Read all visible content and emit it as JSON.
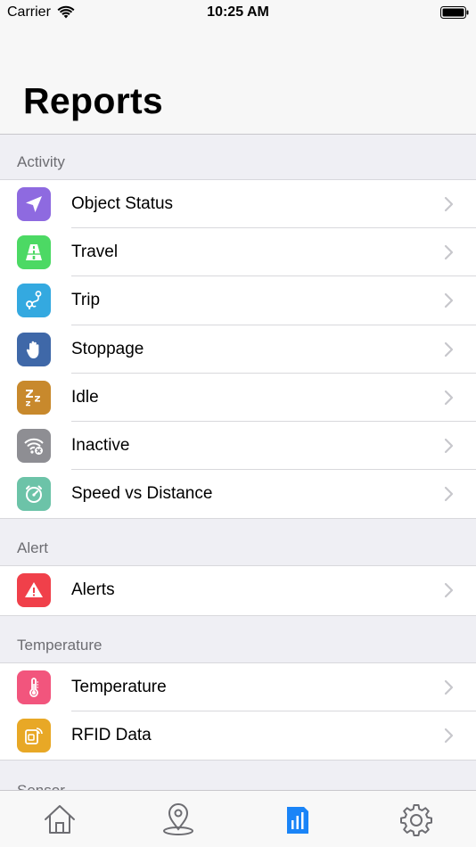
{
  "status_bar": {
    "carrier": "Carrier",
    "time": "10:25 AM"
  },
  "header": {
    "title": "Reports"
  },
  "sections": [
    {
      "title": "Activity",
      "items": [
        {
          "label": "Object Status",
          "icon": "navigation-arrow-icon",
          "color": "#8e6ae0"
        },
        {
          "label": "Travel",
          "icon": "road-icon",
          "color": "#4cd964"
        },
        {
          "label": "Trip",
          "icon": "route-pin-icon",
          "color": "#34a9e0"
        },
        {
          "label": "Stoppage",
          "icon": "hand-icon",
          "color": "#3f68a8"
        },
        {
          "label": "Idle",
          "icon": "sleep-zzz-icon",
          "color": "#c8892c"
        },
        {
          "label": "Inactive",
          "icon": "wifi-off-icon",
          "color": "#8e8e93"
        },
        {
          "label": "Speed vs Distance",
          "icon": "speedometer-icon",
          "color": "#6cc3a8"
        }
      ]
    },
    {
      "title": "Alert",
      "items": [
        {
          "label": "Alerts",
          "icon": "warning-icon",
          "color": "#f0404a"
        }
      ]
    },
    {
      "title": "Temperature",
      "items": [
        {
          "label": "Temperature",
          "icon": "thermometer-icon",
          "color": "#f2557d"
        },
        {
          "label": "RFID Data",
          "icon": "rfid-card-icon",
          "color": "#e8a826"
        }
      ]
    },
    {
      "title": "Sensor",
      "items": []
    }
  ],
  "tab_bar": {
    "active_color": "#1a84f7",
    "inactive_color": "#6d6d72",
    "tabs": [
      {
        "icon": "home-icon",
        "active": false
      },
      {
        "icon": "map-pin-icon",
        "active": false
      },
      {
        "icon": "reports-chart-icon",
        "active": true
      },
      {
        "icon": "gear-icon",
        "active": false
      }
    ]
  }
}
